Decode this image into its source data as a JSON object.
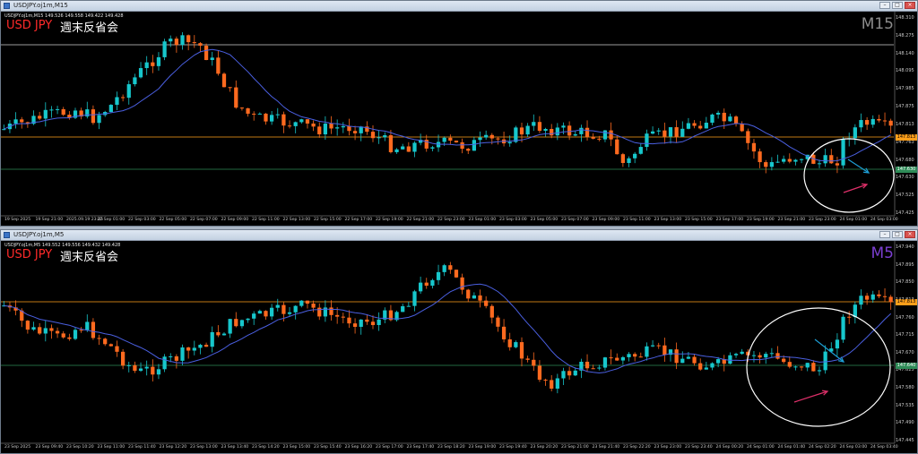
{
  "colors": {
    "bull": "#17c7cc",
    "bear": "#ff6a1f",
    "ma": "#4a5fe0",
    "orange_line": "#ff9f1a",
    "green_line": "#2e8b57",
    "white_line": "#cfcfcf"
  },
  "top": {
    "window_title": "USDJPY.oj1m,M15",
    "symbol_line": "USDJPY.oj1m,M15  149.526 149.558 149.422 149.428",
    "symbol": "USD JPY",
    "caption": "週末反省会",
    "timeframe": "M15",
    "price_labels": [
      "148.310",
      "148.275",
      "148.140",
      "148.095",
      "147.985",
      "147.875",
      "147.813",
      "147.763",
      "147.680",
      "147.630",
      "147.525",
      "147.425"
    ],
    "tag_orange": "147.813",
    "tag_green": "147.630",
    "time_labels": [
      "19 Sep 2025",
      "19 Sep 21:00",
      "2025.09.19 23:45",
      "22 Sep 01:00",
      "22 Sep 03:00",
      "22 Sep 05:00",
      "22 Sep 07:00",
      "22 Sep 09:00",
      "22 Sep 11:00",
      "22 Sep 13:00",
      "22 Sep 15:00",
      "22 Sep 17:00",
      "22 Sep 19:00",
      "22 Sep 21:00",
      "22 Sep 23:00",
      "23 Sep 01:00",
      "23 Sep 03:00",
      "23 Sep 05:00",
      "23 Sep 07:00",
      "23 Sep 09:00",
      "23 Sep 11:00",
      "23 Sep 13:00",
      "23 Sep 15:00",
      "23 Sep 17:00",
      "23 Sep 19:00",
      "23 Sep 21:00",
      "23 Sep 23:00",
      "24 Sep 01:00",
      "24 Sep 03:00"
    ]
  },
  "bottom": {
    "window_title": "USDJPY.oj1m,M5",
    "symbol_line": "USDJPY.oj1m,M5  149.552 149.556 149.432 149.428",
    "symbol": "USD JPY",
    "caption": "週末反省会",
    "timeframe": "M5",
    "price_labels": [
      "147.940",
      "147.895",
      "147.850",
      "147.813",
      "147.760",
      "147.715",
      "147.670",
      "147.625",
      "147.580",
      "147.535",
      "147.490",
      "147.445"
    ],
    "tag_orange": "147.813",
    "tag_green": "147.640",
    "time_labels": [
      "23 Sep 2025",
      "23 Sep 09:40",
      "23 Sep 10:20",
      "23 Sep 11:00",
      "23 Sep 11:40",
      "23 Sep 12:20",
      "23 Sep 13:00",
      "23 Sep 13:40",
      "23 Sep 14:20",
      "23 Sep 15:00",
      "23 Sep 15:40",
      "23 Sep 16:20",
      "23 Sep 17:00",
      "23 Sep 17:40",
      "23 Sep 18:20",
      "23 Sep 19:00",
      "23 Sep 19:40",
      "23 Sep 20:20",
      "23 Sep 21:00",
      "23 Sep 21:40",
      "23 Sep 22:20",
      "23 Sep 23:00",
      "23 Sep 23:40",
      "24 Sep 00:20",
      "24 Sep 01:00",
      "24 Sep 01:40",
      "24 Sep 02:20",
      "24 Sep 03:00",
      "24 Sep 03:40"
    ]
  }
}
